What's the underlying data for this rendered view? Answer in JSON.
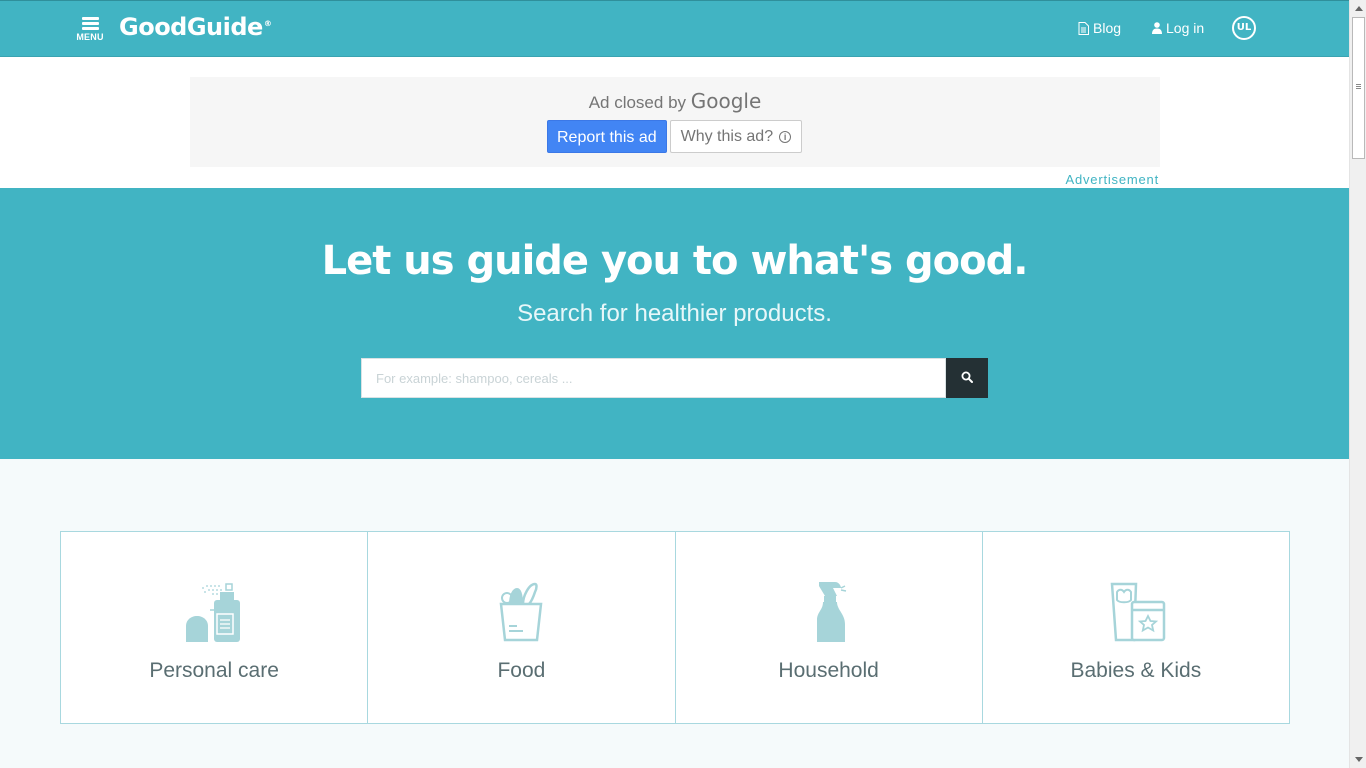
{
  "header": {
    "menu_label": "MENU",
    "logo_text": "GoodGuide",
    "logo_mark": "®",
    "blog_label": "Blog",
    "login_label": "Log in",
    "ul_logo_text": "UL",
    "menu_icon": "hamburger-icon",
    "blog_icon": "document-icon",
    "login_icon": "user-icon"
  },
  "ad": {
    "closed_text": "Ad closed by",
    "closed_brand": "Google",
    "report_label": "Report this ad",
    "why_label": "Why this ad?",
    "advertisement_label": "Advertisement"
  },
  "hero": {
    "title": "Let us guide you to what's good.",
    "subtitle": "Search for healthier products.",
    "search_placeholder": "For example: shampoo, cereals ...",
    "search_value": "",
    "search_icon": "search-icon"
  },
  "categories": [
    {
      "label": "Personal care",
      "icon": "personal-care-icon"
    },
    {
      "label": "Food",
      "icon": "grocery-bag-icon"
    },
    {
      "label": "Household",
      "icon": "spray-bottle-icon"
    },
    {
      "label": "Babies & Kids",
      "icon": "baby-products-icon"
    }
  ],
  "colors": {
    "brand": "#41b4c3",
    "dark": "#243034",
    "ad_blue": "#4285f4",
    "category_icon": "#a6d4d9",
    "category_text": "#5a6e72"
  }
}
